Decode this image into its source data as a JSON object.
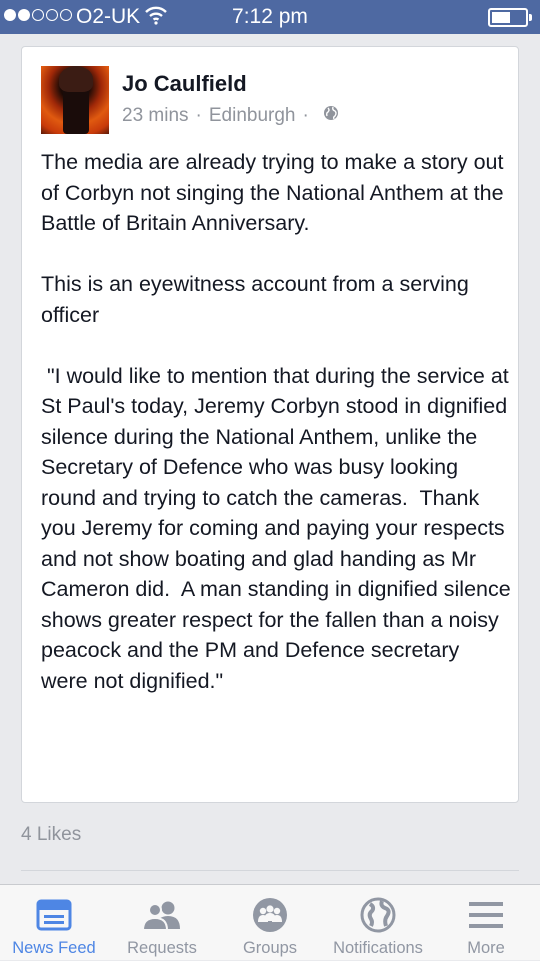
{
  "status_bar": {
    "carrier": "O2-UK",
    "time": "7:12 pm",
    "signal_full": 2,
    "signal_total": 5
  },
  "post": {
    "author": "Jo Caulfield",
    "time_ago": "23 mins",
    "separator": "·",
    "location": "Edinburgh",
    "paragraphs": [
      "The media are already trying to make a story out of Corbyn not singing the National Anthem at the Battle of Britain Anniversary.",
      "This is an eyewitness account from a serving officer",
      " \"I would like to mention that during the service at St Paul's today, Jeremy Corbyn stood in dignified silence during the National Anthem, unlike the Secretary of Defence who was busy looking round and trying to catch the cameras.  Thank you Jeremy for coming and paying your respects and not show boating and glad handing as Mr Cameron did.  A man standing in dignified silence shows greater respect for the fallen than a noisy peacock and the PM and Defence secretary were not dignified.\""
    ],
    "likes": "4 Likes"
  },
  "tabs": [
    {
      "label": "News Feed",
      "icon": "news-feed-icon",
      "active": true
    },
    {
      "label": "Requests",
      "icon": "friend-requests-icon",
      "active": false
    },
    {
      "label": "Groups",
      "icon": "groups-icon",
      "active": false
    },
    {
      "label": "Notifications",
      "icon": "globe-notifications-icon",
      "active": false
    },
    {
      "label": "More",
      "icon": "hamburger-menu-icon",
      "active": false
    }
  ],
  "colors": {
    "status_bar": "#4e69a2",
    "active_tab": "#4e86e4",
    "inactive_tab": "#9197a3"
  }
}
